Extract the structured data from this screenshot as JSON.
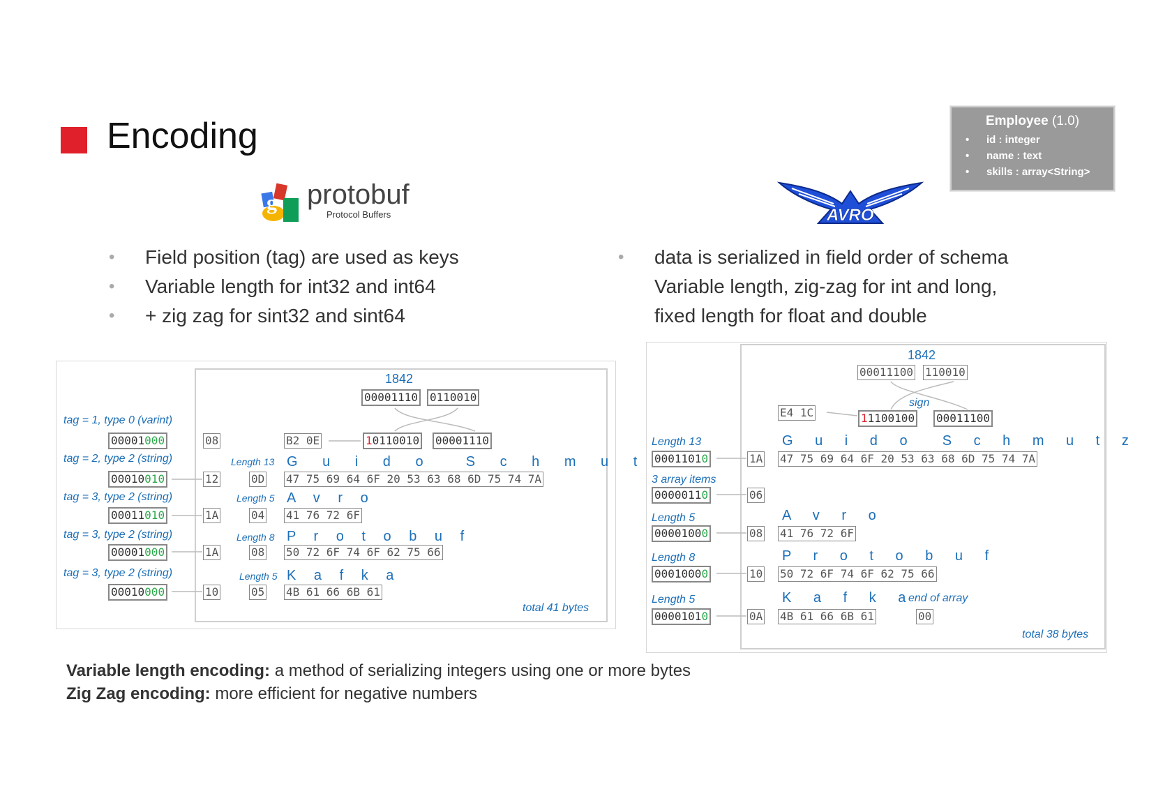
{
  "title": "Encoding",
  "accent_color": "#e0202a",
  "schema_box": {
    "header": "Employee",
    "version": "(1.0)",
    "fields": [
      "id : integer",
      "name : text",
      "skills : array<String>"
    ]
  },
  "protobuf": {
    "logo_text": "protobuf",
    "logo_subtext": "Protocol Buffers",
    "bullets": [
      "Field position (tag) are used as keys",
      "Variable length for int32 and int64",
      "+ zig zag for sint32 and sint64"
    ],
    "diagram": {
      "number": "1842",
      "top_bin": [
        "00001110",
        "0110010"
      ],
      "swap_hex": "B2 0E",
      "swap_bin": [
        "10110010",
        "00001110"
      ],
      "rows": [
        {
          "tag_label": "tag = 1, type 0 (varint)",
          "bin": "00001000",
          "key_hex": "08",
          "len_label": "",
          "len_hex": "",
          "chars": "",
          "hex": ""
        },
        {
          "tag_label": "tag = 2, type 2 (string)",
          "bin": "00010010",
          "key_hex": "12",
          "len_label": "Length 13",
          "len_hex": "0D",
          "chars": "G u i d o  S c h m u t z",
          "hex": "47 75 69 64 6F 20 53 63 68 6D 75 74 7A"
        },
        {
          "tag_label": "tag = 3, type 2 (string)",
          "bin": "00011010",
          "key_hex": "1A",
          "len_label": "Length 5",
          "len_hex": "04",
          "chars": "A v r o",
          "hex": "41 76 72 6F"
        },
        {
          "tag_label": "tag = 3, type 2 (string)",
          "bin": "00001000",
          "key_hex": "1A",
          "len_label": "Length 8",
          "len_hex": "08",
          "chars": "P r o t o b u f",
          "hex": "50 72 6F 74 6F 62 75 66"
        },
        {
          "tag_label": "tag = 3, type 2 (string)",
          "bin": "00010000",
          "key_hex": "10",
          "len_label": "Length 5",
          "len_hex": "05",
          "chars": "K a f k a",
          "hex": "4B 61 66 6B 61"
        }
      ],
      "total": "total 41 bytes"
    }
  },
  "avro": {
    "logo_text": "AVRO",
    "bullets": [
      "data is serialized in field order of schema",
      "Variable length, zig-zag for int and long,",
      "fixed length for float and double"
    ],
    "diagram": {
      "number": "1842",
      "top_bin": [
        "00011100",
        "110010"
      ],
      "sign_label": "sign",
      "swap_hex": "E4 1C",
      "swap_bin": [
        "11100100",
        "00011100"
      ],
      "rows": [
        {
          "label": "Length 13",
          "bin": "00011010",
          "key_hex": "1A",
          "chars": "G u i d o  S c h m u t z",
          "hex": "47 75 69 64 6F 20 53 63 68 6D 75 74 7A"
        },
        {
          "label": "3 array items",
          "bin": "00000110",
          "key_hex": "06",
          "chars": "",
          "hex": ""
        },
        {
          "label": "Length 5",
          "bin": "00001000",
          "key_hex": "08",
          "chars": "A v r o",
          "hex": "41 76 72 6F"
        },
        {
          "label": "Length 8",
          "bin": "00010000",
          "key_hex": "10",
          "chars": "P r o t o b u f",
          "hex": "50 72 6F 74 6F 62 75 66"
        },
        {
          "label": "Length 5",
          "bin": "00001010",
          "key_hex": "0A",
          "chars": "K a f k a",
          "hex": "4B 61 66 6B 61"
        }
      ],
      "end_label": "end of array",
      "end_hex": "00",
      "total": "total 38 bytes"
    }
  },
  "footer": {
    "line1_bold": "Variable length encoding:",
    "line1_rest": " a method of serializing integers using one or more bytes",
    "line2_bold": "Zig Zag encoding:",
    "line2_rest": " more efficient for negative numbers"
  }
}
